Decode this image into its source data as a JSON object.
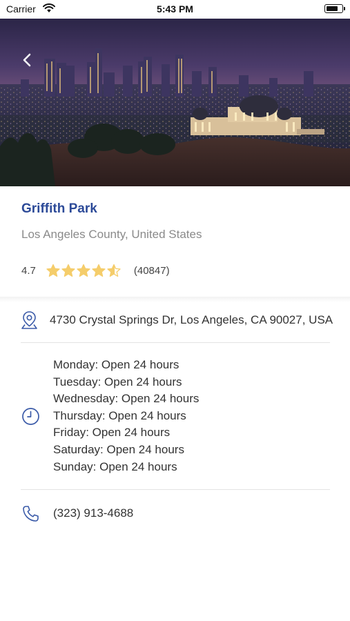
{
  "status_bar": {
    "carrier": "Carrier",
    "time": "5:43 PM"
  },
  "place": {
    "name": "Griffith Park",
    "region": "Los Angeles County, United States",
    "rating": "4.7",
    "rating_fraction": 0.94,
    "reviews": "(40847)",
    "address": "4730 Crystal Springs Dr, Los Angeles, CA 90027, USA",
    "hours": [
      "Monday: Open 24 hours",
      "Tuesday: Open 24 hours",
      "Wednesday: Open 24 hours",
      "Thursday: Open 24 hours",
      "Friday: Open 24 hours",
      "Saturday: Open 24 hours",
      "Sunday: Open 24 hours"
    ],
    "phone": "(323) 913-4688"
  },
  "icons": {
    "back": "chevron-left-icon",
    "address": "map-pin-icon",
    "hours": "clock-icon",
    "phone": "phone-icon",
    "star": "star-icon"
  },
  "colors": {
    "accent": "#2c4a98",
    "star": "#f5cd6b",
    "subtitle": "#8a8a8a",
    "icon": "#3a5aa8"
  }
}
